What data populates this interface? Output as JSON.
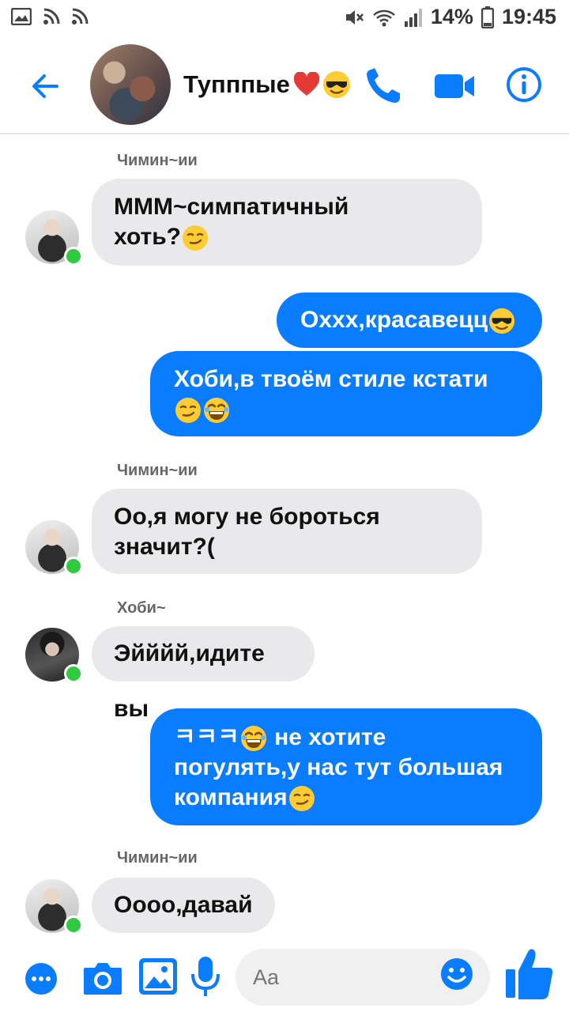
{
  "status_bar": {
    "battery": "14%",
    "time": "19:45"
  },
  "header": {
    "title": "Тупппые",
    "title_emojis": [
      "heart-emoji",
      "sunglasses-emoji"
    ]
  },
  "messages": [
    {
      "type": "label",
      "text": "Чимин~ии"
    },
    {
      "type": "incoming",
      "sender": "Чимин~ии",
      "lines": [
        "МММ~симпатичный",
        "хоть?"
      ],
      "emojis": [
        "smirk-emoji"
      ]
    },
    {
      "type": "outgoing",
      "lines": [
        "Охxx,красавецц"
      ],
      "emojis": [
        "sunglasses-emoji"
      ]
    },
    {
      "type": "outgoing",
      "lines": [
        "Хоби,в твоём стиле кстати"
      ],
      "emojis": [
        "smirk-emoji",
        "laugh-emoji"
      ]
    },
    {
      "type": "label",
      "text": "Чимин~ии"
    },
    {
      "type": "incoming",
      "sender": "Чимин~ии",
      "lines": [
        "Оо,я могу не бороться",
        "значит?("
      ]
    },
    {
      "type": "label",
      "text": "Хоби~"
    },
    {
      "type": "incoming",
      "sender": "Хоби~",
      "lines": [
        "Эйййй,идите вы"
      ]
    },
    {
      "type": "outgoing",
      "lines": [
        "ㅋㅋㅋ",
        " не хотите",
        "погулять,у нас тут большая",
        "компания"
      ],
      "emojis": [
        "laugh-emoji",
        "smirk-emoji"
      ]
    },
    {
      "type": "label",
      "text": "Чимин~ии"
    },
    {
      "type": "incoming",
      "sender": "Чимин~ии",
      "lines": [
        "Оооо,давай"
      ]
    }
  ],
  "m": {
    "l1": "Чимин~ии",
    "b1a": "МММ~симпатичный",
    "b1b": "хоть?",
    "b2": "Охxx,красавецц",
    "b3a": "Хоби,в твоём стиле кстати",
    "l2": "Чимин~ии",
    "b4a": "Оо,я могу не бороться",
    "b4b": "значит?(",
    "l3": "Хоби~",
    "b5": "Эйййй,идите вы",
    "b6a1": "ㅋㅋㅋ",
    "b6a2": " не хотите",
    "b6b": "погулять,у нас тут большая",
    "b6c": "компания",
    "l4": "Чимин~ии",
    "b7": "Оооо,давай"
  },
  "composer": {
    "placeholder": "Aa"
  },
  "colors": {
    "accent": "#0a7cff",
    "incoming_bubble": "#e9e9eb",
    "online": "#31c940"
  }
}
